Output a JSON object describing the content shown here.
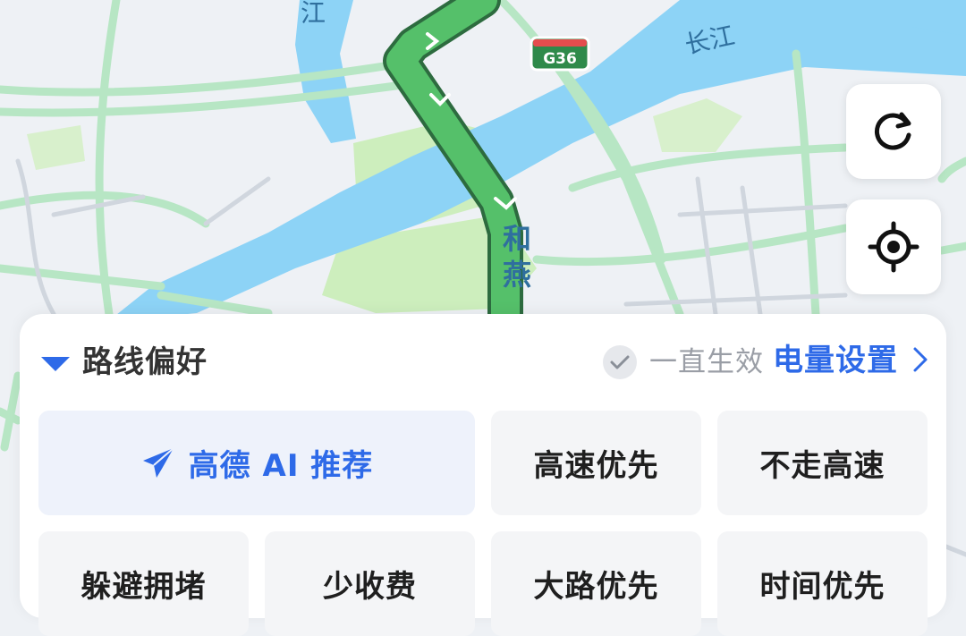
{
  "map": {
    "river_label_left": "江",
    "river_label_right": "长江",
    "highway_shield": "G36",
    "road_label": "和燕"
  },
  "controls": {
    "refresh_icon": "refresh-icon",
    "locate_icon": "locate-icon"
  },
  "panel": {
    "title": "路线偏好",
    "always_on_label": "一直生效",
    "battery_link": "电量设置",
    "options": [
      {
        "label": "高德 AI 推荐",
        "selected": true,
        "icon": "send-icon"
      },
      {
        "label": "高速优先",
        "selected": false
      },
      {
        "label": "不走高速",
        "selected": false
      },
      {
        "label": "躲避拥堵",
        "selected": false
      },
      {
        "label": "少收费",
        "selected": false
      },
      {
        "label": "大路优先",
        "selected": false
      },
      {
        "label": "时间优先",
        "selected": false
      }
    ]
  },
  "colors": {
    "accent": "#2e6ae8",
    "route_green": "#55c06a",
    "water": "#8dd3f6",
    "road_green": "#b7e6c4"
  }
}
